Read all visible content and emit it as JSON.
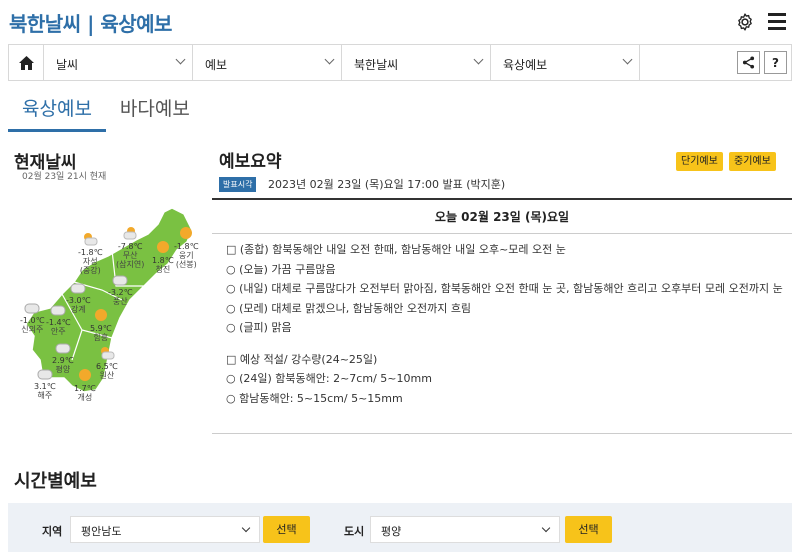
{
  "header": {
    "title": "북한날씨 | 육상예보"
  },
  "breadcrumb": {
    "items": [
      {
        "label": "날씨"
      },
      {
        "label": "예보"
      },
      {
        "label": "북한날씨"
      },
      {
        "label": "육상예보"
      }
    ],
    "help_label": "?"
  },
  "tabs": [
    {
      "label": "육상예보",
      "active": true
    },
    {
      "label": "바다예보",
      "active": false
    }
  ],
  "current": {
    "title": "현재날씨",
    "date": "02월 23일 21시 현재",
    "stations": [
      {
        "temp": "-7.8℃",
        "name": "무산\n(삼지연)",
        "icon": "partly-cloudy-night-icon"
      },
      {
        "temp": "-1.8℃",
        "name": "웅기\n(선봉)",
        "icon": "sunny-icon"
      },
      {
        "temp": "1.8℃",
        "name": "청진",
        "icon": "sunny-icon"
      },
      {
        "temp": "-1.8℃",
        "name": "자성\n(중강)",
        "icon": "partly-cloudy-icon"
      },
      {
        "temp": "-3.0℃",
        "name": "강계",
        "icon": "cloudy-icon"
      },
      {
        "temp": "-3.2℃",
        "name": "풍산",
        "icon": "cloudy-icon"
      },
      {
        "temp": "-1.0℃",
        "name": "신의주",
        "icon": "cloudy-icon"
      },
      {
        "temp": "-1.4℃",
        "name": "안주",
        "icon": "cloudy-icon"
      },
      {
        "temp": "5.9℃",
        "name": "함흥",
        "icon": "sunny-icon"
      },
      {
        "temp": "2.9℃",
        "name": "평양",
        "icon": "cloudy-icon"
      },
      {
        "temp": "6.5℃",
        "name": "원산",
        "icon": "partly-cloudy-icon"
      },
      {
        "temp": "3.1℃",
        "name": "해주",
        "icon": "cloudy-icon"
      },
      {
        "temp": "1.7℃",
        "name": "개성",
        "icon": "sunny-icon"
      }
    ]
  },
  "forecast": {
    "title": "예보요약",
    "btn_short": "단기예보",
    "btn_mid": "중기예보",
    "pub_badge": "발표시각",
    "pub_text": "2023년 02월 23일 (목)요일 17:00 발표 (박지훈)",
    "date_header": "오늘 02월 23일 (목)요일",
    "lines": [
      "□ (종합) 함북동해안 내일 오전 한때, 함남동해안 내일 오후~모레 오전 눈",
      "○ (오늘) 가끔 구름많음",
      "○ (내일) 대체로 구름많다가 오전부터 맑아짐, 함북동해안 오전 한때 눈 곳, 함남동해안 흐리고 오후부터 모레 오전까지 눈",
      "○ (모레) 대체로 맑겠으나, 함남동해안 오전까지 흐림",
      "○ (글피) 맑음"
    ],
    "lines2": [
      "□ 예상 적설/ 강수량(24~25일)",
      "○ (24일) 함북동해안: 2~7cm/ 5~10mm",
      "○ 함남동해안: 5~15cm/ 5~15mm"
    ]
  },
  "hourly": {
    "title": "시간별예보",
    "region_label": "지역",
    "region_value": "평안남도",
    "city_label": "도시",
    "city_value": "평양",
    "select_label": "선택"
  }
}
